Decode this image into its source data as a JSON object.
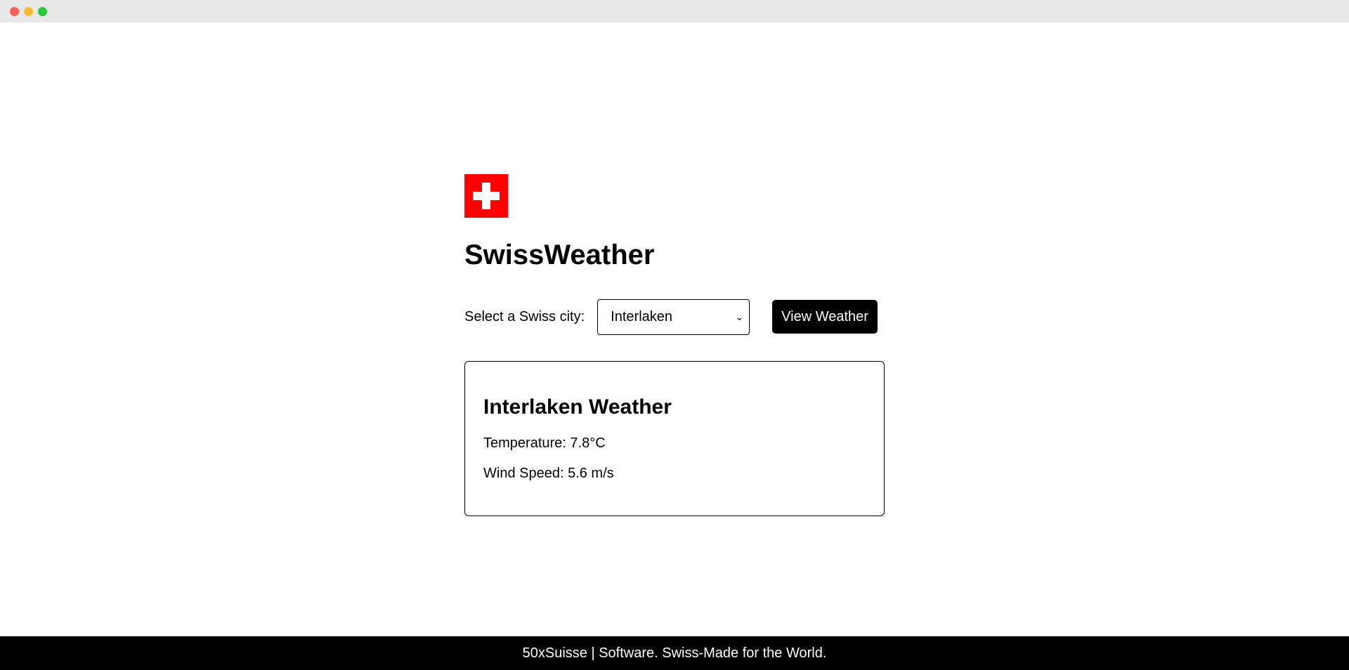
{
  "window": {
    "controls": [
      "close",
      "minimize",
      "maximize"
    ]
  },
  "app": {
    "title": "SwissWeather",
    "logo_icon": "swiss-flag-icon",
    "colors": {
      "flag_red": "#ff0000",
      "button_bg": "#000000",
      "footer_bg": "#000000"
    }
  },
  "controls": {
    "city_label": "Select a Swiss city:",
    "selected_city": "Interlaken",
    "view_button_label": "View Weather"
  },
  "weather": {
    "title": "Interlaken Weather",
    "temperature": "Temperature: 7.8°C",
    "wind_speed": "Wind Speed: 5.6 m/s"
  },
  "footer": {
    "text": "50xSuisse | Software. Swiss-Made for the World."
  }
}
